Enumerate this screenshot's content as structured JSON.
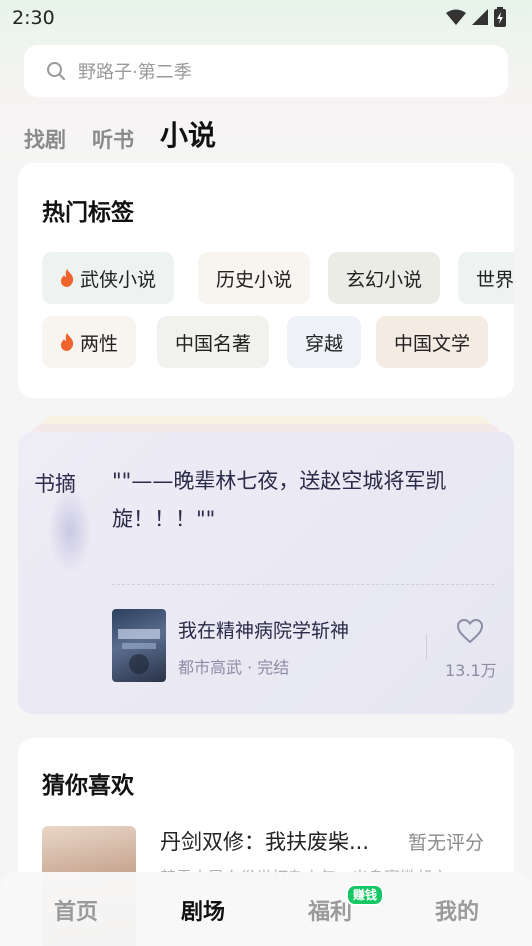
{
  "status_bar": {
    "time": "2:30"
  },
  "search": {
    "placeholder": "野路子·第二季"
  },
  "top_tabs": [
    {
      "label": "找剧"
    },
    {
      "label": "听书"
    },
    {
      "label": "小说",
      "active": true
    }
  ],
  "hot_tags": {
    "title": "热门标签",
    "row1": [
      {
        "label": "武侠小说",
        "hot": true,
        "bg": "#eef3f1"
      },
      {
        "label": "历史小说",
        "hot": false,
        "bg": "#f8f4f0"
      },
      {
        "label": "玄幻小说",
        "hot": false,
        "bg": "#ecece6"
      },
      {
        "label": "世界",
        "hot": false,
        "bg": "#eef3f1"
      }
    ],
    "row2": [
      {
        "label": "两性",
        "hot": true,
        "bg": "#f8f4f0"
      },
      {
        "label": "中国名著",
        "hot": false,
        "bg": "#f1f1ed"
      },
      {
        "label": "穿越",
        "hot": false,
        "bg": "#eef2f7"
      },
      {
        "label": "中国文学",
        "hot": false,
        "bg": "#f4ebe3"
      }
    ]
  },
  "excerpt": {
    "label": "书摘",
    "text": "\"\"——晚辈林七夜，送赵空城将军凯旋！！！\"\"",
    "book_title": "我在精神病院学斩神",
    "book_meta": "都市高武 · 完结",
    "likes": "13.1万"
  },
  "recommend": {
    "title": "猜你喜欢",
    "book_title": "丹剑双修：我扶废柴...",
    "rating": "暂无评分",
    "desc": "楚雷大异自俗世打杂少年，出身寒微却之"
  },
  "bottom_nav": [
    {
      "label": "首页"
    },
    {
      "label": "剧场",
      "active": true
    },
    {
      "label": "福利",
      "badge": "赚钱"
    },
    {
      "label": "我的"
    }
  ],
  "colors": {
    "accent_green": "#17c765",
    "fire": "#f0632d"
  }
}
